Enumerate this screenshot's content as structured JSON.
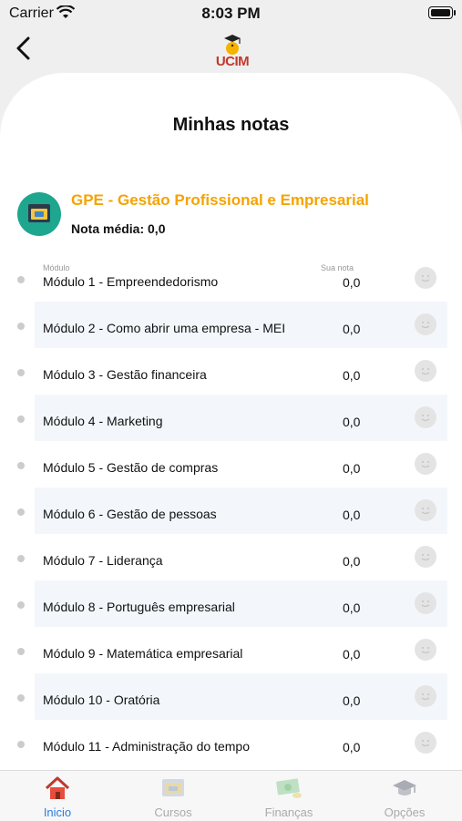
{
  "status_bar": {
    "carrier": "Carrier",
    "time": "8:03 PM"
  },
  "header": {
    "logo_text": "UCIM"
  },
  "page": {
    "title": "Minhas notas"
  },
  "course": {
    "name": "GPE - Gestão Profissional e Empresarial",
    "average": "Nota média: 0,0"
  },
  "columns": {
    "module": "Módulo",
    "grade": "Sua nota"
  },
  "modules": [
    {
      "label": "Módulo 1 - Empreendedorismo",
      "grade": "0,0"
    },
    {
      "label": "Módulo 2 - Como abrir uma empresa  - MEI",
      "grade": "0,0"
    },
    {
      "label": "Módulo 3 - Gestão financeira",
      "grade": "0,0"
    },
    {
      "label": "Módulo 4 - Marketing",
      "grade": "0,0"
    },
    {
      "label": "Módulo 5 - Gestão de compras",
      "grade": "0,0"
    },
    {
      "label": "Módulo 6 - Gestão de pessoas",
      "grade": "0,0"
    },
    {
      "label": "Módulo 7 - Liderança",
      "grade": "0,0"
    },
    {
      "label": "Módulo 8 - Português empresarial",
      "grade": "0,0"
    },
    {
      "label": "Módulo 9 - Matemática empresarial",
      "grade": "0,0"
    },
    {
      "label": "Módulo 10 - Oratória",
      "grade": "0,0"
    },
    {
      "label": "Módulo 11 - Administração do tempo",
      "grade": "0,0"
    }
  ],
  "tabs": [
    {
      "label": "Inicio",
      "icon": "home-icon",
      "active": true
    },
    {
      "label": "Cursos",
      "icon": "course-icon",
      "active": false
    },
    {
      "label": "Finanças",
      "icon": "money-icon",
      "active": false
    },
    {
      "label": "Opções",
      "icon": "graduation-cap-icon",
      "active": false
    }
  ],
  "colors": {
    "accent": "#f5a300",
    "tab_active": "#2a7de1",
    "course_icon_bg": "#1ea68f",
    "row_alt": "#f3f7fb"
  }
}
